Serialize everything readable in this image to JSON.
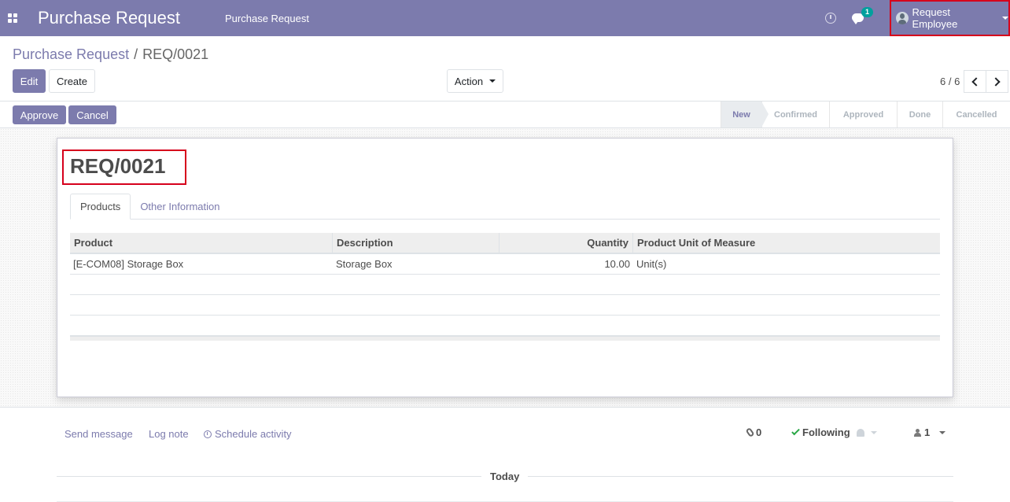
{
  "navbar": {
    "brand": "Purchase Request",
    "menu_item": "Purchase Request",
    "chat_badge": "1",
    "user_name": "Request Employee",
    "accent_color": "#7c7bad"
  },
  "breadcrumb": {
    "parent": "Purchase Request",
    "separator": "/",
    "current": "REQ/0021"
  },
  "toolbar": {
    "edit_label": "Edit",
    "create_label": "Create",
    "action_label": "Action"
  },
  "pager": {
    "value": "6 / 6"
  },
  "statusbar": {
    "approve_label": "Approve",
    "cancel_label": "Cancel",
    "stages": [
      "New",
      "Confirmed",
      "Approved",
      "Done",
      "Cancelled"
    ],
    "active_stage": "New"
  },
  "form": {
    "title": "REQ/0021",
    "tabs": [
      "Products",
      "Other Information"
    ],
    "active_tab": "Products",
    "table": {
      "headers": [
        "Product",
        "Description",
        "Quantity",
        "Product Unit of Measure"
      ],
      "rows": [
        [
          "[E-COM08] Storage Box",
          "Storage Box",
          "10.00",
          "Unit(s)"
        ]
      ]
    }
  },
  "chatter": {
    "send_message": "Send message",
    "log_note": "Log note",
    "schedule_activity": "Schedule activity",
    "attachments_count": "0",
    "following_label": "Following",
    "followers_count": "1",
    "today_label": "Today"
  }
}
